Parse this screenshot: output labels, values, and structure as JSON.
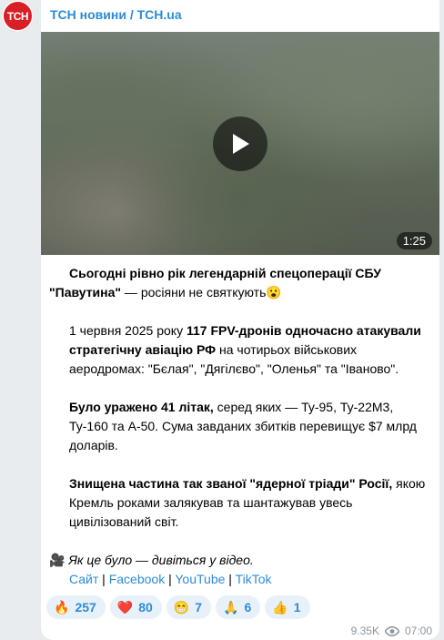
{
  "channel": {
    "name": "ТСН новини / TCH.ua",
    "avatar_text": "ТСН"
  },
  "video": {
    "duration": "1:25"
  },
  "post": {
    "p1_a": "Сьогодні рівно рік легендарній спецоперації СБУ",
    "p1_b": "\"Павутина\"",
    "p1_c": " — росіяни не святкують😮",
    "p2_a": "1 червня 2025 року ",
    "p2_b": "117 FPV-дронів одночасно атакували стратегічну авіацію РФ",
    "p2_c": " на чотирьох військових аеродромах: \"Бєлая\", \"Дягілєво\", \"Оленья\" та \"Іваново\".",
    "p3_a": "Було уражено 41 літак,",
    "p3_b": " серед яких — Ту-95, Ту-22М3, Ту-160 та А-50. Сума завданих збитків перевищує $7 млрд доларів.",
    "p4_a": "Знищена частина так званої \"ядерної тріади\" Росії,",
    "p4_b": " якою Кремль роками залякував та шантажував увесь цивілізований світ.",
    "p5_emoji": "🎥",
    "p5_text": " Як це було — дивіться у відео."
  },
  "links": {
    "site": "Сайт",
    "facebook": "Facebook",
    "youtube": "YouTube",
    "tiktok": "TikTok",
    "sep": " | "
  },
  "reactions": [
    {
      "emoji": "🔥",
      "count": "257"
    },
    {
      "emoji": "❤️",
      "count": "80"
    },
    {
      "emoji": "😁",
      "count": "7"
    },
    {
      "emoji": "🙏",
      "count": "6"
    },
    {
      "emoji": "👍",
      "count": "1"
    }
  ],
  "meta": {
    "views": "9.35K",
    "time": "07:00"
  },
  "colors": {
    "accent": "#2d8bd6",
    "brand": "#d91f26",
    "reaction_bg": "#e8f1fa",
    "meta": "#8a959e"
  }
}
